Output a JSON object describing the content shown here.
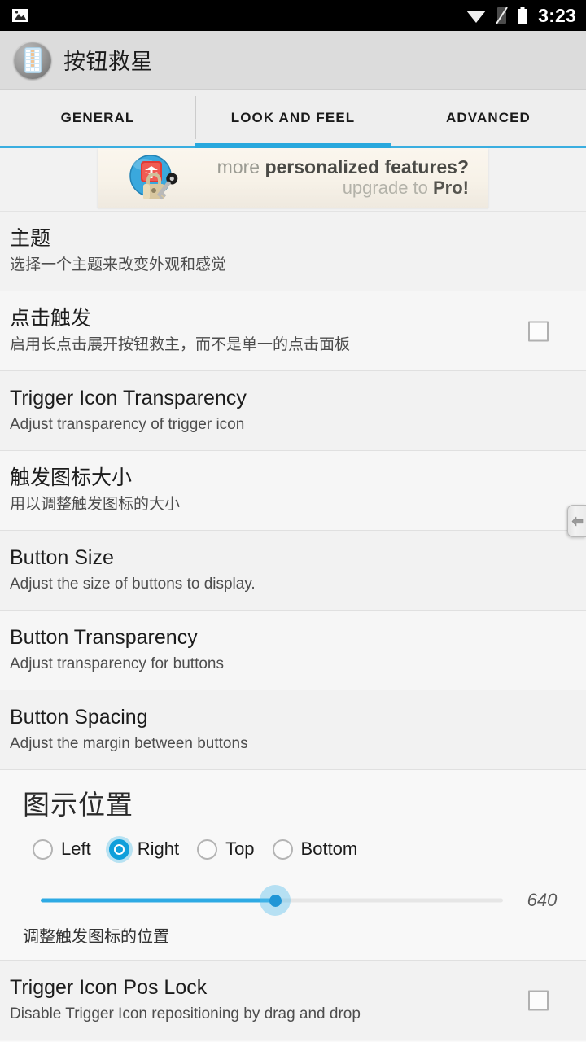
{
  "statusbar": {
    "time": "3:23",
    "icons": [
      "image-icon",
      "wifi-icon",
      "no-sim-icon",
      "battery-icon"
    ]
  },
  "actionbar": {
    "title": "按钮救星",
    "icon": "app-icon"
  },
  "tabs": {
    "items": [
      {
        "label": "GENERAL",
        "active": false
      },
      {
        "label": "LOOK AND FEEL",
        "active": true
      },
      {
        "label": "ADVANCED",
        "active": false
      }
    ],
    "accent_color": "#29a8dd"
  },
  "banner": {
    "line1_prefix": "more ",
    "line1_bold": "personalized features?",
    "line2_prefix": "upgrade to ",
    "line2_bold": "Pro!",
    "icon": "lock-and-key-icon"
  },
  "preferences": [
    {
      "title": "主题",
      "summary": "选择一个主题来改变外观和感觉",
      "has_checkbox": false,
      "checked": false
    },
    {
      "title": "点击触发",
      "summary": "启用长点击展开按钮救主，而不是单一的点击面板",
      "has_checkbox": true,
      "checked": false
    },
    {
      "title": "Trigger Icon Transparency",
      "summary": "Adjust transparency of trigger icon",
      "has_checkbox": false,
      "checked": false
    },
    {
      "title": "触发图标大小",
      "summary": "用以调整触发图标的大小",
      "has_checkbox": false,
      "checked": false
    },
    {
      "title": "Button Size",
      "summary": "Adjust the size of buttons to display.",
      "has_checkbox": false,
      "checked": false
    },
    {
      "title": "Button Transparency",
      "summary": "Adjust transparency for buttons",
      "has_checkbox": false,
      "checked": false
    },
    {
      "title": "Button Spacing",
      "summary": "Adjust the margin between buttons",
      "has_checkbox": false,
      "checked": false
    }
  ],
  "position_section": {
    "title": "图示位置",
    "radios": [
      {
        "label": "Left",
        "checked": false
      },
      {
        "label": "Right",
        "checked": true
      },
      {
        "label": "Top",
        "checked": false
      },
      {
        "label": "Bottom",
        "checked": false
      }
    ],
    "slider_value": "640",
    "caption": "调整触发图标的位置",
    "accent_color": "#2eaae4"
  },
  "last_preference": {
    "title": "Trigger Icon Pos Lock",
    "summary": "Disable Trigger Icon repositioning by drag and drop",
    "checked": false
  },
  "floating_trigger": {
    "glyph": "⇐"
  }
}
